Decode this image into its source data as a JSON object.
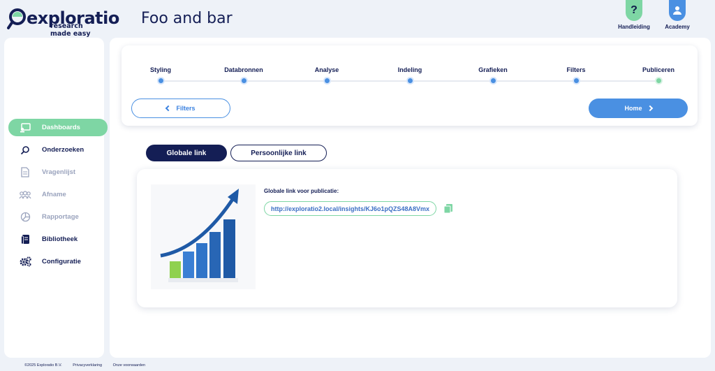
{
  "brand": {
    "name": "exploratio",
    "tagline": "research made easy"
  },
  "page_title": "Foo and bar",
  "header_buttons": [
    {
      "label": "Handleiding",
      "icon": "question-icon",
      "color": "#7ed6a4"
    },
    {
      "label": "Academy",
      "icon": "user-icon",
      "color": "#4a90e2"
    }
  ],
  "sidebar": {
    "items": [
      {
        "label": "Dashboards",
        "icon": "dashboard-icon",
        "state": "active"
      },
      {
        "label": "Onderzoeken",
        "icon": "search-icon",
        "state": "dark"
      },
      {
        "label": "Vragenlijst",
        "icon": "document-icon",
        "state": "dim"
      },
      {
        "label": "Afname",
        "icon": "people-icon",
        "state": "dim"
      },
      {
        "label": "Rapportage",
        "icon": "pie-chart-icon",
        "state": "dim"
      },
      {
        "label": "Bibliotheek",
        "icon": "library-icon",
        "state": "dark"
      },
      {
        "label": "Configuratie",
        "icon": "gears-icon",
        "state": "dark"
      }
    ]
  },
  "wizard": {
    "steps": [
      {
        "label": "Styling",
        "status": "pending"
      },
      {
        "label": "Databronnen",
        "status": "pending"
      },
      {
        "label": "Analyse",
        "status": "pending"
      },
      {
        "label": "Indeling",
        "status": "pending"
      },
      {
        "label": "Grafieken",
        "status": "pending"
      },
      {
        "label": "Filters",
        "status": "pending"
      },
      {
        "label": "Publiceren",
        "status": "current"
      }
    ],
    "back_label": "Filters",
    "next_label": "Home"
  },
  "tabs": {
    "global": "Globale link",
    "personal": "Persoonlijke link",
    "active": "global"
  },
  "publish": {
    "label": "Globale link voor publicatie:",
    "url": "http://exploratio2.local/insights/KJ6o1pQZS48A8Vmx"
  },
  "footer": {
    "copyright": "©2025 Exploratio B.V.",
    "privacy": "Privacyverklaring",
    "terms": "Onze voorwaarden"
  },
  "colors": {
    "navy": "#141e55",
    "accent_green": "#7ed6a4",
    "accent_blue": "#4a90e2"
  }
}
